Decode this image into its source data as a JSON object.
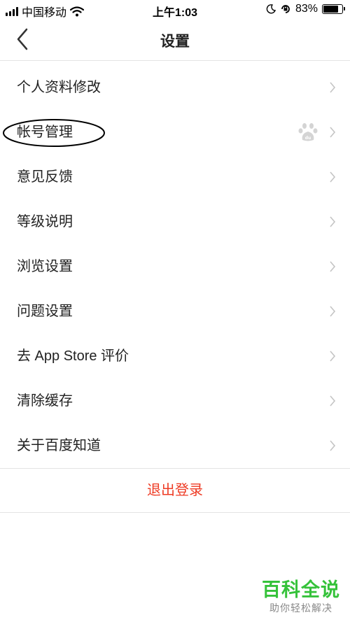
{
  "status_bar": {
    "carrier": "中国移动",
    "time": "上午1:03",
    "battery_percent": "83%",
    "battery_level": 0.83,
    "icons": [
      "signal-icon",
      "wifi-icon",
      "moon-icon",
      "orientation-lock-icon",
      "battery-icon"
    ]
  },
  "nav": {
    "title": "设置",
    "back_icon": "chevron-left-icon"
  },
  "settings": {
    "items": [
      {
        "label": "个人资料修改"
      },
      {
        "label": "帐号管理",
        "extra_icon": "baidu-paw-icon",
        "circled": true
      },
      {
        "label": "意见反馈"
      },
      {
        "label": "等级说明"
      },
      {
        "label": "浏览设置"
      },
      {
        "label": "问题设置"
      },
      {
        "label": "去 App Store 评价"
      },
      {
        "label": "清除缓存"
      },
      {
        "label": "关于百度知道"
      }
    ],
    "chevron_icon": "chevron-right-icon"
  },
  "logout": {
    "label": "退出登录",
    "color": "#ee3b24"
  },
  "watermark": {
    "title": "百科全说",
    "subtitle": "助你轻松解决",
    "color": "#35c23a"
  }
}
